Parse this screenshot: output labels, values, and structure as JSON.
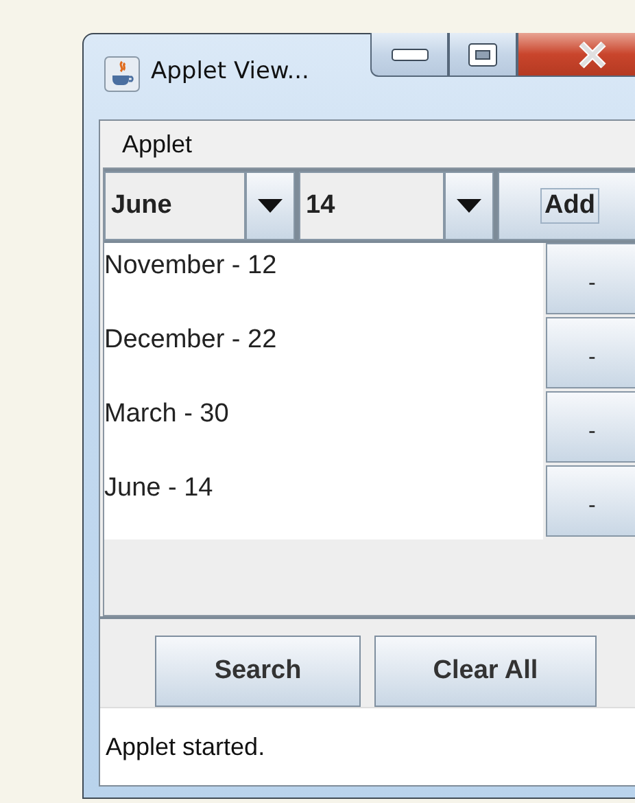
{
  "window": {
    "title": "Applet View..."
  },
  "menu": [
    "Applet"
  ],
  "selectors": [
    {
      "value": "June"
    },
    {
      "value": "14"
    }
  ],
  "add_button": "Add",
  "entries": [
    {
      "text": "November - 12",
      "remove": "-"
    },
    {
      "text": "December - 22",
      "remove": "-"
    },
    {
      "text": "March - 30",
      "remove": "-"
    },
    {
      "text": "June - 14",
      "remove": "-"
    }
  ],
  "buttons": [
    "Search",
    "Clear All"
  ],
  "status": "Applet started."
}
